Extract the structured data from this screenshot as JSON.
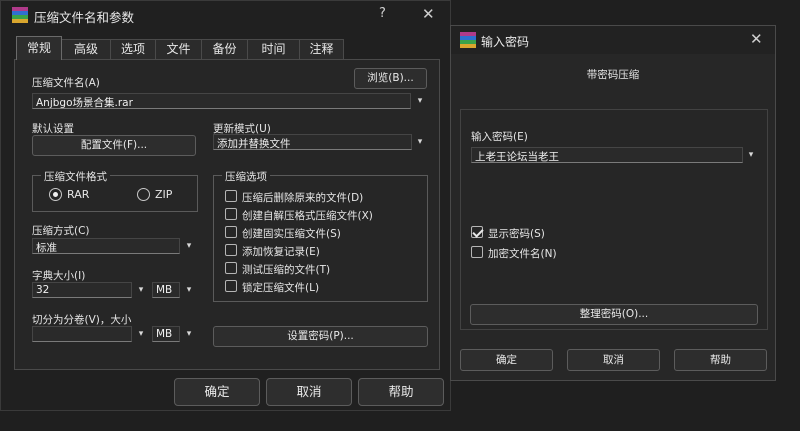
{
  "main_dialog": {
    "title": "压缩文件名和参数",
    "help_glyph": "?",
    "close_glyph": "✕",
    "tabs": [
      "常规",
      "高级",
      "选项",
      "文件",
      "备份",
      "时间",
      "注释"
    ],
    "archive_name_label": "压缩文件名(A)",
    "browse_button": "浏览(B)...",
    "archive_name_value": "Anjbgo场景合集.rar",
    "default_settings_label": "默认设置",
    "profiles_button": "配置文件(F)...",
    "update_mode_label": "更新模式(U)",
    "update_mode_value": "添加并替换文件",
    "format_group_title": "压缩文件格式",
    "format_options": [
      "RAR",
      "ZIP"
    ],
    "format_selected": "RAR",
    "compression_method_label": "压缩方式(C)",
    "compression_method_value": "标准",
    "dictionary_size_label": "字典大小(I)",
    "dictionary_size_value": "32",
    "dictionary_unit": "MB",
    "split_volumes_label": "切分为分卷(V)，大小",
    "split_volumes_value": "",
    "split_unit": "MB",
    "archiving_options_title": "压缩选项",
    "archiving_options": [
      {
        "label": "压缩后删除原来的文件(D)",
        "checked": false
      },
      {
        "label": "创建自解压格式压缩文件(X)",
        "checked": false
      },
      {
        "label": "创建固实压缩文件(S)",
        "checked": false
      },
      {
        "label": "添加恢复记录(E)",
        "checked": false
      },
      {
        "label": "测试压缩的文件(T)",
        "checked": false
      },
      {
        "label": "锁定压缩文件(L)",
        "checked": false
      }
    ],
    "set_password_button": "设置密码(P)...",
    "ok_button": "确定",
    "cancel_button": "取消",
    "help_button": "帮助"
  },
  "password_dialog": {
    "title": "输入密码",
    "close_glyph": "✕",
    "subtitle": "带密码压缩",
    "enter_password_label": "输入密码(E)",
    "password_value": "上老王论坛当老王",
    "show_password_label": "显示密码(S)",
    "show_password_checked": true,
    "encrypt_names_label": "加密文件名(N)",
    "encrypt_names_checked": false,
    "organize_button": "整理密码(O)...",
    "ok_button": "确定",
    "cancel_button": "取消",
    "help_button": "帮助"
  },
  "icons": {
    "app": "winrar-books-icon",
    "dropdown": "chevron-down-icon"
  },
  "colors": {
    "background": "#1f1f1f",
    "window": "#202020",
    "panel": "#262626",
    "password_window": "#272727",
    "text": "#e6e6e6"
  }
}
